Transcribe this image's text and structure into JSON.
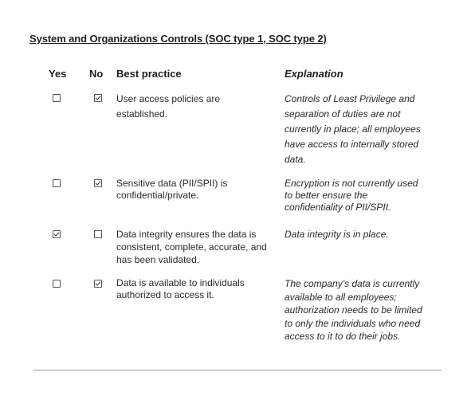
{
  "title": "System and Organizations Controls (SOC type 1, SOC type 2)",
  "headers": {
    "yes": "Yes",
    "no": "No",
    "practice": "Best practice",
    "explanation": "Explanation"
  },
  "rows": [
    {
      "yes_checked": false,
      "no_checked": true,
      "practice": "User access policies are established.",
      "explanation": "Controls of Least Privilege and separation of duties are not currently in place; all employees have access to internally stored data."
    },
    {
      "yes_checked": false,
      "no_checked": true,
      "practice": "Sensitive data (PII/SPII) is confidential/private.",
      "explanation": "Encryption is not currently used to better ensure the confidentiality of PII/SPII."
    },
    {
      "yes_checked": true,
      "no_checked": false,
      "practice": "Data integrity ensures the data is consistent, complete, accurate, and has been validated.",
      "explanation": "Data integrity is in place."
    },
    {
      "yes_checked": false,
      "no_checked": true,
      "practice": "Data is available to individuals authorized to access it.",
      "explanation": "The company’s data is currently available to all employees; authorization needs to be limited to only the individuals who need access to it to do their jobs."
    }
  ],
  "icons": {
    "checked": "check-icon"
  }
}
